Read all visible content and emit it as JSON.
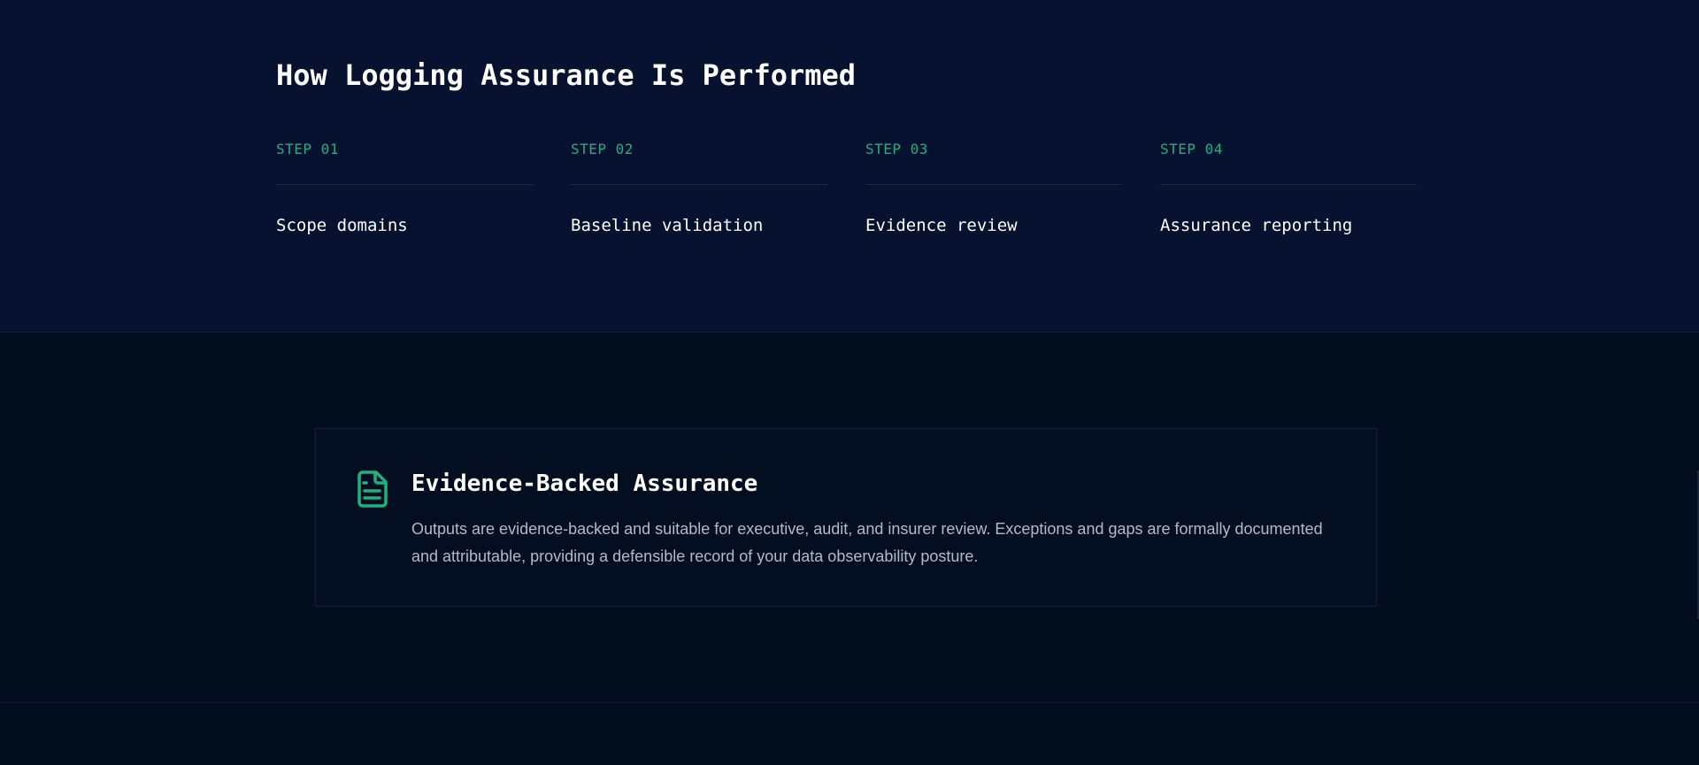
{
  "process": {
    "title": "How Logging Assurance Is Performed",
    "steps": [
      {
        "label": "STEP 01",
        "title": "Scope domains"
      },
      {
        "label": "STEP 02",
        "title": "Baseline validation"
      },
      {
        "label": "STEP 03",
        "title": "Evidence review"
      },
      {
        "label": "STEP 04",
        "title": "Assurance reporting"
      }
    ]
  },
  "evidence_card": {
    "icon": "document-icon",
    "title": "Evidence-Backed Assurance",
    "body": "Outputs are evidence-backed and suitable for executive, audit, and insurer review. Exceptions and gaps are formally documented and attributable, providing a defensible record of your data observability posture."
  },
  "colors": {
    "accent": "#22b07d",
    "top_background": "#061230",
    "bottom_background": "#020d1e",
    "text_primary": "#ffffff",
    "text_secondary": "#b3bac6"
  }
}
